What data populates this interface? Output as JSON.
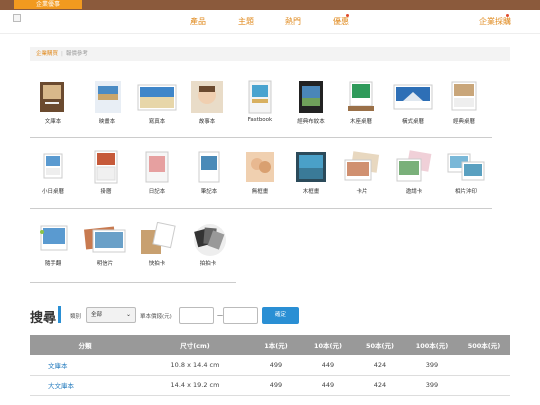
{
  "topbar": {
    "tab_label": "企業優事"
  },
  "nav": {
    "items": [
      "產品",
      "主題",
      "熱門",
      "優惠",
      "企業採購"
    ]
  },
  "breadcrumb": {
    "link": "企業購買",
    "current": "報價參考"
  },
  "products_row1": [
    "文庫本",
    "映畫本",
    "寫真本",
    "故事本",
    "Fastbook",
    "經典布紋本",
    "木座桌曆",
    "橫式桌曆",
    "經典桌曆"
  ],
  "products_row2": [
    "小日桌曆",
    "掛曆",
    "日記本",
    "筆記本",
    "無框畫",
    "木框畫",
    "卡片",
    "邀請卡",
    "相片沖印"
  ],
  "products_row3": [
    "隨手翻",
    "明信片",
    "快拍卡",
    "拍拍卡"
  ],
  "search": {
    "title": "搜尋",
    "category_label": "類別",
    "category_value": "全部",
    "price_label": "單本價錢(元)",
    "dash": "—",
    "confirm_label": "確定"
  },
  "table": {
    "headers": [
      "分類",
      "尺寸(cm)",
      "1本(元)",
      "10本(元)",
      "50本(元)",
      "100本(元)",
      "500本(元)"
    ],
    "rows": [
      [
        "文庫本",
        "10.8 x 14.4 cm",
        "499",
        "449",
        "424",
        "399",
        ""
      ],
      [
        "大文庫本",
        "14.4 x 19.2 cm",
        "499",
        "449",
        "424",
        "399",
        ""
      ]
    ]
  },
  "colors": {
    "accent": "#e08a1e",
    "brand_brown": "#8b5a3c",
    "button_blue": "#2a8fd4"
  }
}
